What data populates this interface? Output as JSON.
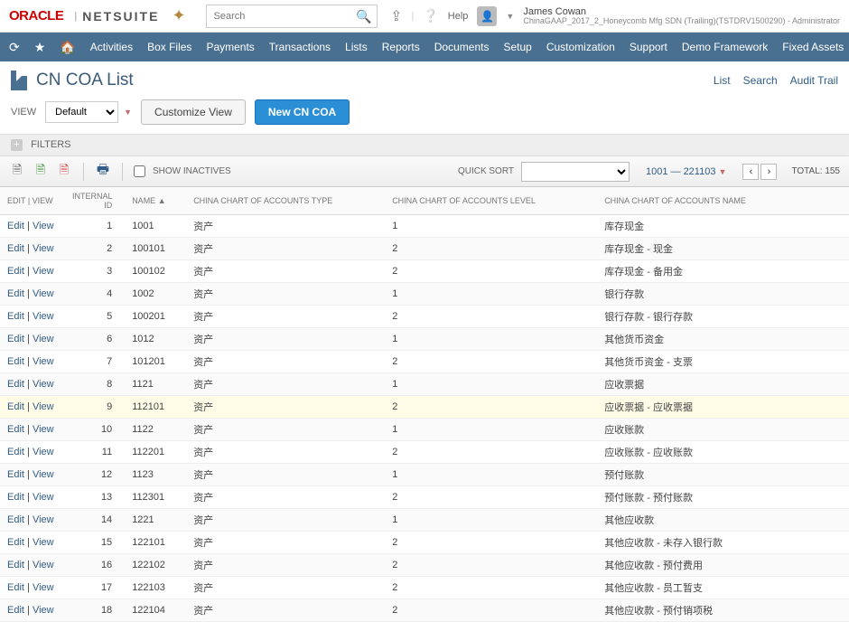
{
  "top": {
    "oracle": "ORACLE",
    "netsuite": "NETSUITE",
    "search_placeholder": "Search",
    "help": "Help",
    "user_name": "James Cowan",
    "user_role": "ChinaGAAP_2017_2_Honeycomb Mfg SDN (Trailing)(TSTDRV1500290) - Administrator"
  },
  "nav": {
    "items": [
      "Activities",
      "Box Files",
      "Payments",
      "Transactions",
      "Lists",
      "Reports",
      "Documents",
      "Setup",
      "Customization",
      "Support",
      "Demo Framework",
      "Fixed Assets"
    ]
  },
  "page": {
    "title": "CN COA List",
    "links": [
      "List",
      "Search",
      "Audit Trail"
    ],
    "view_label": "VIEW",
    "view_value": "Default",
    "customize": "Customize View",
    "new_btn": "New CN COA",
    "filters": "FILTERS"
  },
  "toolbar": {
    "show_inactives": "SHOW INACTIVES",
    "quick_sort": "QUICK SORT",
    "range": "1001 — 221103",
    "total": "TOTAL: 155"
  },
  "table": {
    "headers": {
      "action": "EDIT | VIEW",
      "id": "INTERNAL ID",
      "name": "NAME ▲",
      "type": "CHINA CHART OF ACCOUNTS TYPE",
      "level": "CHINA CHART OF ACCOUNTS LEVEL",
      "acct_name": "CHINA CHART OF ACCOUNTS NAME"
    },
    "edit": "Edit",
    "view": "View",
    "rows": [
      {
        "id": "1",
        "name": "1001",
        "type": "资产",
        "level": "1",
        "acct": "库存现金"
      },
      {
        "id": "2",
        "name": "100101",
        "type": "资产",
        "level": "2",
        "acct": "库存现金 - 现金"
      },
      {
        "id": "3",
        "name": "100102",
        "type": "资产",
        "level": "2",
        "acct": "库存现金 - 备用金"
      },
      {
        "id": "4",
        "name": "1002",
        "type": "资产",
        "level": "1",
        "acct": "银行存款"
      },
      {
        "id": "5",
        "name": "100201",
        "type": "资产",
        "level": "2",
        "acct": "银行存款 - 银行存款"
      },
      {
        "id": "6",
        "name": "1012",
        "type": "资产",
        "level": "1",
        "acct": "其他货币资金"
      },
      {
        "id": "7",
        "name": "101201",
        "type": "资产",
        "level": "2",
        "acct": "其他货币资金 - 支票"
      },
      {
        "id": "8",
        "name": "1121",
        "type": "资产",
        "level": "1",
        "acct": "应收票据"
      },
      {
        "id": "9",
        "name": "112101",
        "type": "资产",
        "level": "2",
        "acct": "应收票据 - 应收票据",
        "hl": true
      },
      {
        "id": "10",
        "name": "1122",
        "type": "资产",
        "level": "1",
        "acct": "应收账款"
      },
      {
        "id": "11",
        "name": "112201",
        "type": "资产",
        "level": "2",
        "acct": "应收账款 - 应收账款"
      },
      {
        "id": "12",
        "name": "1123",
        "type": "资产",
        "level": "1",
        "acct": "预付账款"
      },
      {
        "id": "13",
        "name": "112301",
        "type": "资产",
        "level": "2",
        "acct": "预付账款 - 预付账款"
      },
      {
        "id": "14",
        "name": "1221",
        "type": "资产",
        "level": "1",
        "acct": "其他应收款"
      },
      {
        "id": "15",
        "name": "122101",
        "type": "资产",
        "level": "2",
        "acct": "其他应收款 - 未存入银行款"
      },
      {
        "id": "16",
        "name": "122102",
        "type": "资产",
        "level": "2",
        "acct": "其他应收款 - 预付费用"
      },
      {
        "id": "17",
        "name": "122103",
        "type": "资产",
        "level": "2",
        "acct": "其他应收款 - 员工暂支"
      },
      {
        "id": "18",
        "name": "122104",
        "type": "资产",
        "level": "2",
        "acct": "其他应收款 - 预付销项税"
      }
    ]
  }
}
